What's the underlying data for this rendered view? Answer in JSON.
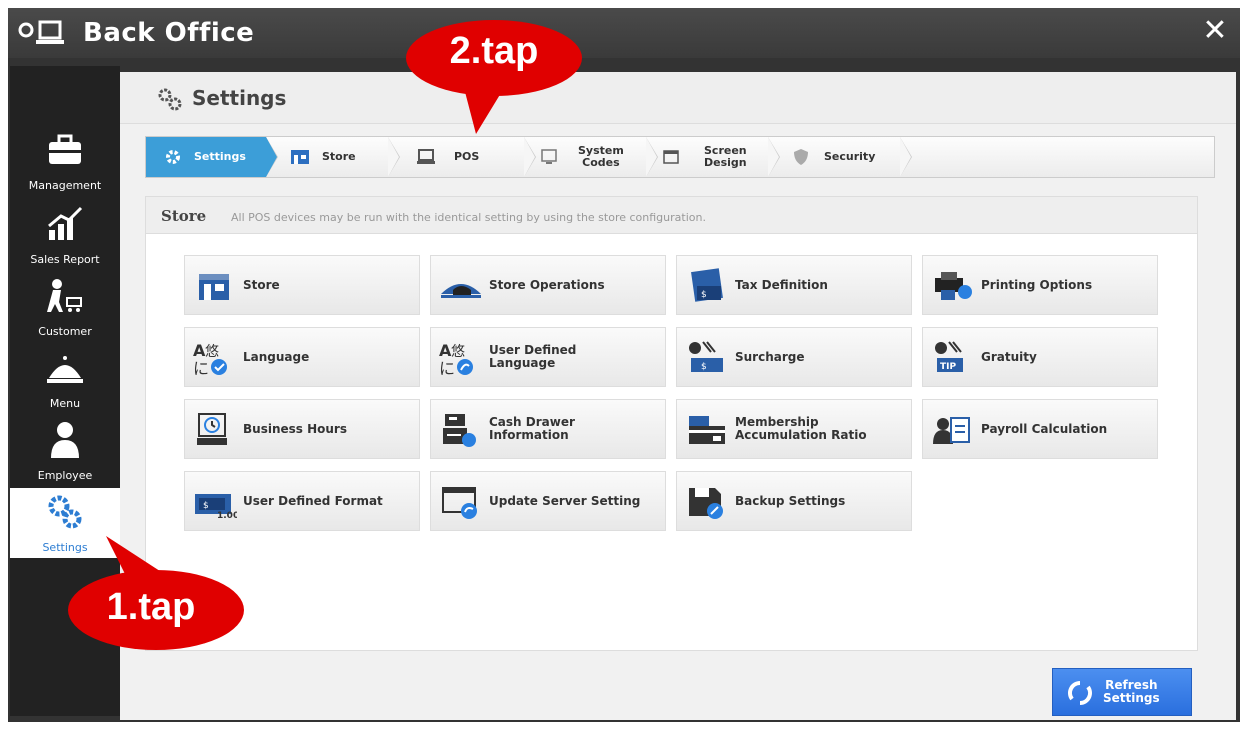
{
  "window": {
    "title": "Back Office",
    "close_label": "✕"
  },
  "sidebar": {
    "items": [
      {
        "label": "Management"
      },
      {
        "label": "Sales Report"
      },
      {
        "label": "Customer"
      },
      {
        "label": "Menu"
      },
      {
        "label": "Employee"
      },
      {
        "label": "Settings"
      }
    ]
  },
  "header": {
    "title": "Settings"
  },
  "breadcrumb": [
    {
      "label": "Settings"
    },
    {
      "label": "Store"
    },
    {
      "label": "POS"
    },
    {
      "label": "System\nCodes"
    },
    {
      "label": "Screen\nDesign"
    },
    {
      "label": "Security"
    }
  ],
  "panel": {
    "title": "Store",
    "description": "All POS devices may be run with the identical setting by using the store configuration."
  },
  "tiles": [
    {
      "label": "Store"
    },
    {
      "label": "Store Operations"
    },
    {
      "label": "Tax Definition"
    },
    {
      "label": "Printing Options"
    },
    {
      "label": "Language"
    },
    {
      "label": "User Defined\nLanguage"
    },
    {
      "label": "Surcharge"
    },
    {
      "label": "Gratuity"
    },
    {
      "label": "Business Hours"
    },
    {
      "label": "Cash Drawer\nInformation"
    },
    {
      "label": "Membership\nAccumulation Ratio"
    },
    {
      "label": "Payroll Calculation"
    },
    {
      "label": "User Defined Format"
    },
    {
      "label": "Update Server Setting"
    },
    {
      "label": "Backup Settings"
    }
  ],
  "refresh_button": {
    "label": "Refresh\nSettings"
  },
  "callouts": {
    "tap1": "1.tap",
    "tap2": "2.tap"
  },
  "colors": {
    "accent": "#3c9ed8",
    "callout": "#e00000",
    "button": "#2a6fde"
  }
}
